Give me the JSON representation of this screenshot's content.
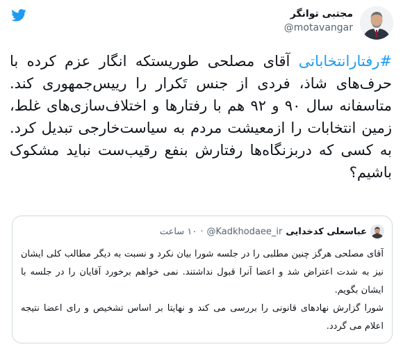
{
  "author": {
    "name": "مجتبی توانگر",
    "handle": "@motavangar"
  },
  "icons": {
    "brand": "twitter-bird-icon",
    "brand_color": "#1d9bf0"
  },
  "tweet": {
    "hashtag": "#رفتارانتخاباتی",
    "text": " آقای مصلحی طوریستکه انگار عزم کرده با حرف‌های شاذ، فردی از جنس تَکرار را رییس‌جمهوری کند. متاسفانه سال ۹۰ و ۹۲ هم با رفتارها و اختلاف‌سازی‌های غلط، زمین انتخابات را ازمعیشت مردم به سیاست‌خارجی تبدیل کرد. به کسی که دربزنگاه‌ها رفتارش بنفع رقیب‌ست نباید مشکوک باشیم؟"
  },
  "quoted": {
    "name": "عباسعلی کدخدایی",
    "handle": "@Kadkhodaee_ir",
    "separator": "·",
    "time": "۱۰ ساعت",
    "paragraph1": "آقای مصلحی هرگز چنین مطلبی را در جلسه شورا بیان نکرد و نسبت به دیگر مطالب کلی ایشان نیز به شدت اعتراض شد و اعضا آنرا قبول نداشتند. نمی خواهم برخورد آقایان را در جلسه با ایشان بگویم.",
    "paragraph2": "شورا گزارش نهادهای قانونی را بررسی می کند و نهایتا بر اساس تشخیص و رای اعضا نتیجه اعلام می گردد."
  }
}
